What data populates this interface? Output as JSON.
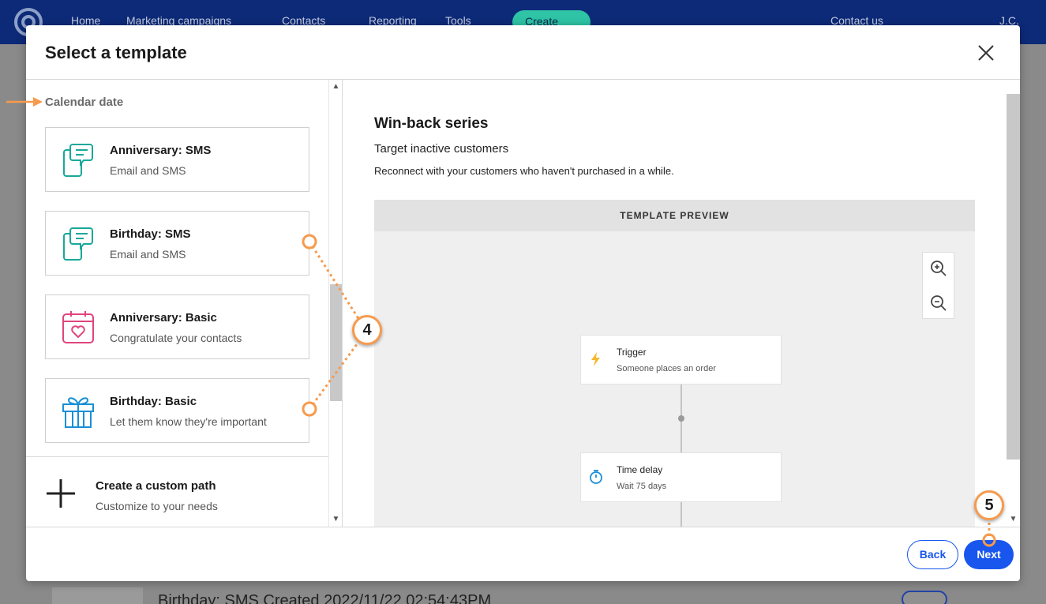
{
  "background": {
    "nav": [
      "Home",
      "Marketing campaigns",
      "Contacts",
      "Reporting",
      "Tools"
    ],
    "create_label": "Create",
    "contact_us": "Contact us",
    "user_initials": "J.C.",
    "row_text": "Birthday: SMS Created 2022/11/22 02:54:43PM"
  },
  "modal": {
    "title": "Select a template",
    "section_label": "Calendar date",
    "templates": [
      {
        "name": "Anniversary: SMS",
        "desc": "Email and SMS",
        "icon": "sms-phone-icon"
      },
      {
        "name": "Birthday: SMS",
        "desc": "Email and SMS",
        "icon": "sms-phone-icon"
      },
      {
        "name": "Anniversary: Basic",
        "desc": "Congratulate your contacts",
        "icon": "calendar-heart-icon"
      },
      {
        "name": "Birthday: Basic",
        "desc": "Let them know they're important",
        "icon": "gift-icon"
      }
    ],
    "custom_path": {
      "name": "Create a custom path",
      "desc": "Customize to your needs"
    },
    "preview": {
      "title": "Win-back series",
      "subtitle": "Target inactive customers",
      "description": "Reconnect with your customers who haven't purchased in a while.",
      "header": "TEMPLATE PREVIEW",
      "nodes": [
        {
          "title": "Trigger",
          "desc": "Someone places an order",
          "icon": "lightning-icon"
        },
        {
          "title": "Time delay",
          "desc": "Wait 75 days",
          "icon": "stopwatch-icon"
        }
      ]
    },
    "footer": {
      "back_label": "Back",
      "next_label": "Next"
    }
  },
  "annotations": {
    "badge_4": "4",
    "badge_5": "5"
  },
  "colors": {
    "accent": "#1856ed",
    "annotation": "#f79a4c",
    "teal_icon": "#1aa89a",
    "pink_icon": "#e0447c",
    "blue_icon": "#1a8fd6"
  }
}
